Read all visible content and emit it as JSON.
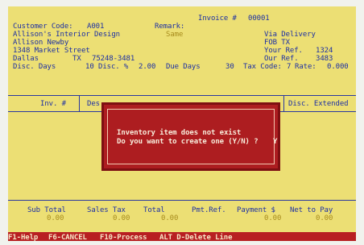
{
  "header": {
    "invoice_label": "Invoice #",
    "invoice_number": "00001",
    "customer_code_label": "Customer Code:",
    "customer_code": "A001",
    "remark_label": "Remark:",
    "remark_value": "Same",
    "customer_name": "Allison's Interior Design",
    "contact_name": "Allison Newby",
    "street": "1348 Market Street",
    "city": "Dallas",
    "state": "TX",
    "zip": "75248-3481",
    "via_label": "Via Delivery",
    "fob_label": "FOB TX",
    "your_ref_label": "Your Ref.",
    "your_ref": "1324",
    "our_ref_label": "Our Ref.",
    "our_ref": "3483",
    "disc_days_label": "Disc. Days",
    "disc_days": "10",
    "disc_pct_label": "Disc. %",
    "disc_pct": "2.00",
    "due_days_label": "Due Days",
    "due_days": "30",
    "tax_code_label": "Tax Code:",
    "tax_code": "7",
    "rate_label": "Rate:",
    "rate": "0.000"
  },
  "columns": {
    "inv_no": "Inv. #",
    "desc_partial": "Des",
    "disc_extended": "Disc. Extended"
  },
  "dialog": {
    "line1": "Inventory item does not exist",
    "line2": "Do you want to create one (Y/N) ?",
    "answer": "Y"
  },
  "totals": {
    "sub_total_label": "Sub Total",
    "sub_total": "0.00",
    "sales_tax_label": "Sales Tax",
    "sales_tax": "0.00",
    "total_label": "Total",
    "total": "0.00",
    "pmt_ref_label": "Pmt.Ref.",
    "payment_label": "Payment $",
    "payment": "0.00",
    "net_to_pay_label": "Net to Pay",
    "net_to_pay": "0.00"
  },
  "footer": {
    "f1": "F1-Help",
    "f6": "F6-CANCEL",
    "f10": "F10-Process",
    "alt_d": "ALT D-Delete Line"
  }
}
